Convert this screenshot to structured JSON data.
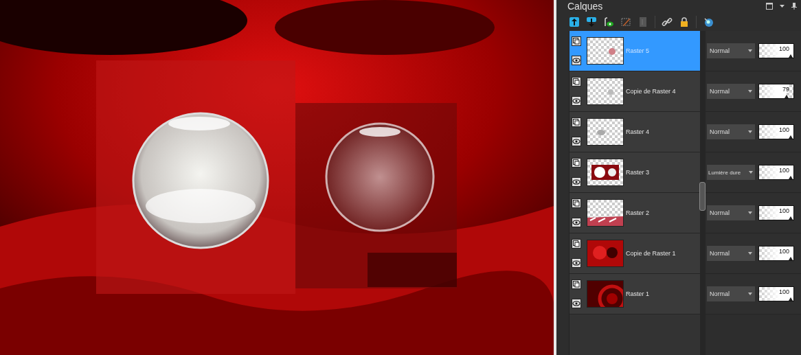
{
  "panel": {
    "title": "Calques"
  },
  "layers": [
    {
      "name": "Raster 5",
      "selected": true,
      "visible": true,
      "blend_mode": "Normal",
      "opacity": "100",
      "level": 1
    },
    {
      "name": "Copie de Raster 4",
      "selected": false,
      "visible": true,
      "blend_mode": "Normal",
      "opacity": "79",
      "level": 0.79
    },
    {
      "name": "Raster 4",
      "selected": false,
      "visible": true,
      "blend_mode": "Normal",
      "opacity": "100",
      "level": 1
    },
    {
      "name": "Raster 3",
      "selected": false,
      "visible": true,
      "blend_mode": "Lumière dure",
      "opacity": "100",
      "level": 1
    },
    {
      "name": "Raster 2",
      "selected": false,
      "visible": true,
      "blend_mode": "Normal",
      "opacity": "100",
      "level": 1
    },
    {
      "name": "Copie de Raster 1",
      "selected": false,
      "visible": true,
      "blend_mode": "Normal",
      "opacity": "100",
      "level": 1
    },
    {
      "name": "Raster 1",
      "selected": false,
      "visible": true,
      "blend_mode": "Normal",
      "opacity": "100",
      "level": 1
    }
  ]
}
